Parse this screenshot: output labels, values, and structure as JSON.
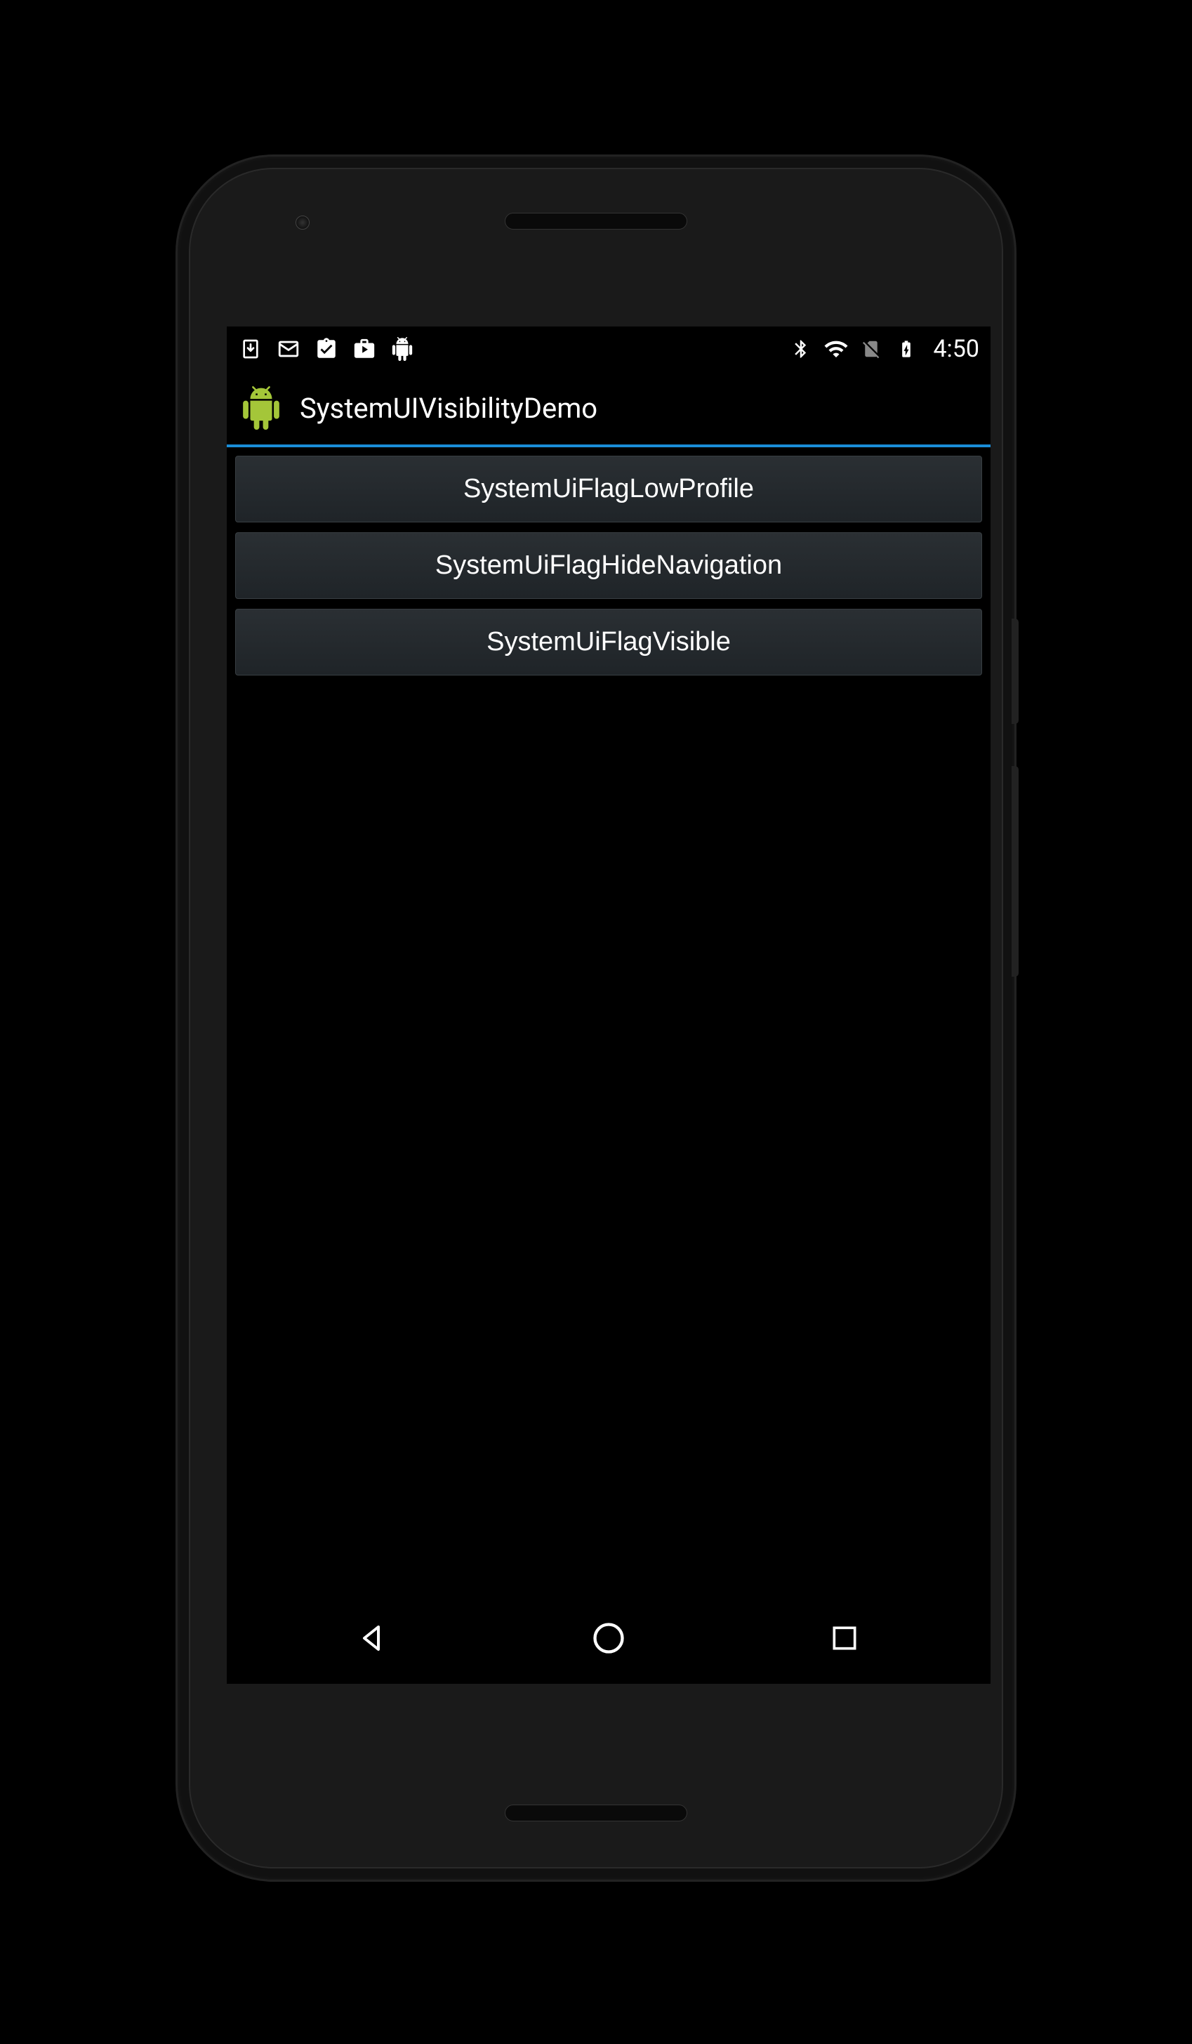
{
  "statusBar": {
    "time": "4:50"
  },
  "actionBar": {
    "title": "SystemUIVisibilityDemo"
  },
  "buttons": [
    {
      "label": "SystemUiFlagLowProfile"
    },
    {
      "label": "SystemUiFlagHideNavigation"
    },
    {
      "label": "SystemUiFlagVisible"
    }
  ]
}
